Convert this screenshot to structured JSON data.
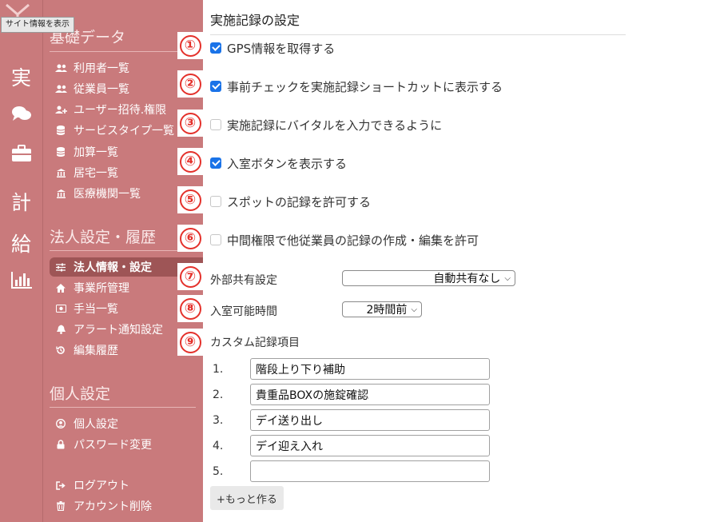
{
  "tooltip": "サイト情報を表示",
  "rail": {
    "jitsu": "実",
    "kei": "計",
    "kyu": "給"
  },
  "nav": {
    "basic_title": "基礎データ",
    "basic_items": [
      {
        "label": "利用者一覧",
        "icon": "users-icon"
      },
      {
        "label": "従業員一覧",
        "icon": "users-icon"
      },
      {
        "label": "ユーザー招待.権限",
        "icon": "user-plus-icon"
      },
      {
        "label": "サービスタイプ一覧",
        "icon": "database-icon"
      },
      {
        "label": "加算一覧",
        "icon": "database-icon"
      },
      {
        "label": "居宅一覧",
        "icon": "bank-icon"
      },
      {
        "label": "医療機関一覧",
        "icon": "bank-icon"
      }
    ],
    "corp_title": "法人設定・履歴",
    "corp_items": [
      {
        "label": "法人情報・設定",
        "icon": "sliders-icon"
      },
      {
        "label": "事業所管理",
        "icon": "home-icon"
      },
      {
        "label": "手当一覧",
        "icon": "money-icon"
      },
      {
        "label": "アラート通知設定",
        "icon": "bell-icon"
      },
      {
        "label": "編集履歴",
        "icon": "history-icon"
      }
    ],
    "personal_title": "個人設定",
    "personal_items": [
      {
        "label": "個人設定",
        "icon": "user-circle-icon"
      },
      {
        "label": "パスワード変更",
        "icon": "lock-icon"
      }
    ],
    "bottom_items": [
      {
        "label": "ログアウト",
        "icon": "sign-out-icon"
      },
      {
        "label": "アカウント削除",
        "icon": "trash-icon"
      }
    ]
  },
  "badges": [
    "①",
    "②",
    "③",
    "④",
    "⑤",
    "⑥",
    "⑦",
    "⑧",
    "⑨"
  ],
  "main": {
    "title": "実施記録の設定",
    "checkboxes": [
      {
        "label": "GPS情報を取得する",
        "checked": true
      },
      {
        "label": "事前チェックを実施記録ショートカットに表示する",
        "checked": true
      },
      {
        "label": "実施記録にバイタルを入力できるように",
        "checked": false
      },
      {
        "label": "入室ボタンを表示する",
        "checked": true
      },
      {
        "label": "スポットの記録を許可する",
        "checked": false
      },
      {
        "label": "中間権限で他従業員の記録の作成・編集を許可",
        "checked": false
      }
    ],
    "external_share_label": "外部共有設定",
    "external_share_value": "自動共有なし",
    "entry_time_label": "入室可能時間",
    "entry_time_value": "2時間前",
    "custom_title": "カスタム記録項目",
    "custom_items": [
      {
        "num": "1.",
        "value": "階段上り下り補助"
      },
      {
        "num": "2.",
        "value": "貴重品BOXの施錠確認"
      },
      {
        "num": "3.",
        "value": "デイ送り出し"
      },
      {
        "num": "4.",
        "value": "デイ迎え入れ"
      },
      {
        "num": "5.",
        "value": ""
      }
    ],
    "more_button": "+もっと作る"
  },
  "colors": {
    "sidebar": "#c97a7c",
    "active_item": "#9e5556",
    "badge_red": "#e4312b",
    "checkbox_blue": "#1a73e8"
  }
}
